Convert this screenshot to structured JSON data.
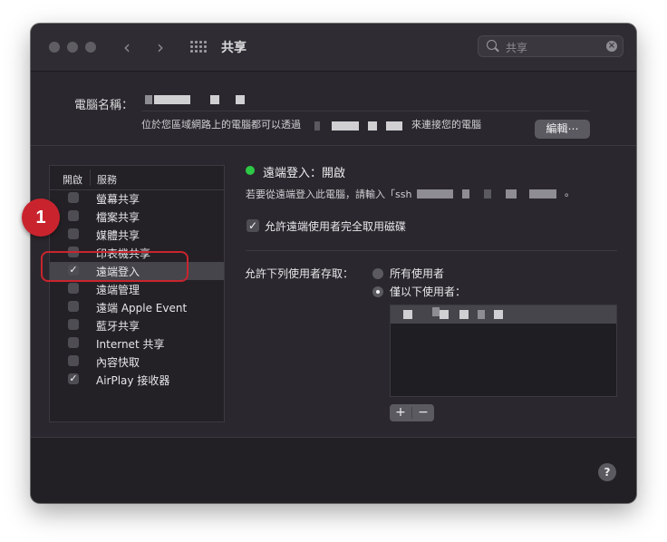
{
  "window": {
    "title": "共享"
  },
  "toolbar": {
    "back_icon": "‹",
    "forward_icon": "›",
    "grid_icon": "grid-icon"
  },
  "search": {
    "value": "共享",
    "clear_icon": "×"
  },
  "header": {
    "computer_name_label": "電腦名稱：",
    "address_prefix": "位於您區域網路上的電腦都可以透過",
    "address_suffix": "來連接您的電腦",
    "edit_button": "編輯⋯"
  },
  "services": {
    "col_on": "開啟",
    "col_service": "服務",
    "items": [
      {
        "label": "螢幕共享",
        "checked": false
      },
      {
        "label": "檔案共享",
        "checked": false
      },
      {
        "label": "媒體共享",
        "checked": false
      },
      {
        "label": "印表機共享",
        "checked": false
      },
      {
        "label": "遠端登入",
        "checked": true,
        "selected": true
      },
      {
        "label": "遠端管理",
        "checked": false
      },
      {
        "label": "遠端 Apple Event",
        "checked": false
      },
      {
        "label": "藍牙共享",
        "checked": false
      },
      {
        "label": "Internet 共享",
        "checked": false
      },
      {
        "label": "內容快取",
        "checked": false
      },
      {
        "label": "AirPlay 接收器",
        "checked": true
      }
    ]
  },
  "callout": {
    "number": "1"
  },
  "detail": {
    "status": "遠端登入：開啟",
    "hint": "若要從遠端登入此電腦，請輸入「ssh",
    "hint_end": "。",
    "full_disk_access": "允許遠端使用者完全取用磁碟",
    "allow_label": "允許下列使用者存取：",
    "option_all": "所有使用者",
    "option_only": "僅以下使用者："
  },
  "buttons": {
    "add": "+",
    "remove": "−",
    "help": "?"
  },
  "colors": {
    "status_on": "#2ec947",
    "callout": "#c9242e"
  }
}
